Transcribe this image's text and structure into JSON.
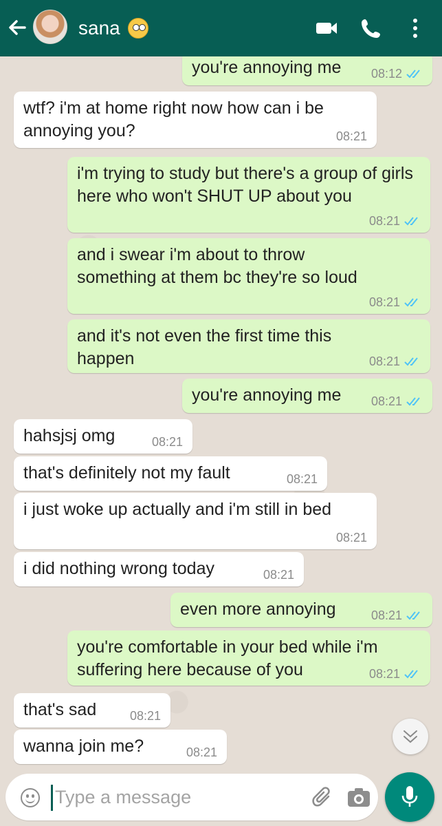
{
  "header": {
    "contact_name": "sana",
    "status_emoji": "face-with-rolling-eyes",
    "icons": [
      "back-arrow-icon",
      "video-call-icon",
      "voice-call-icon",
      "more-options-icon"
    ],
    "color": "#075e54"
  },
  "messages": [
    {
      "direction": "out",
      "text": "you're annoying me",
      "time": "08:12",
      "ticks": "read"
    },
    {
      "direction": "in",
      "text": "wtf? i'm at home right now how can i be annoying you?",
      "time": "08:21"
    },
    {
      "direction": "out",
      "text": "i'm trying to study but there's a group of girls here who won't SHUT UP about you",
      "time": "08:21",
      "ticks": "read"
    },
    {
      "direction": "out",
      "text": "and i swear i'm about to throw something at them bc they're so loud",
      "time": "08:21",
      "ticks": "read"
    },
    {
      "direction": "out",
      "text": "and it's not even the first time this happen",
      "time": "08:21",
      "ticks": "read"
    },
    {
      "direction": "out",
      "text": "you're annoying me",
      "time": "08:21",
      "ticks": "read"
    },
    {
      "direction": "in",
      "text": "hahsjsj omg",
      "time": "08:21"
    },
    {
      "direction": "in",
      "text": "that's definitely not my fault",
      "time": "08:21"
    },
    {
      "direction": "in",
      "text": "i just woke up actually and i'm still in bed",
      "time": "08:21"
    },
    {
      "direction": "in",
      "text": "i did nothing wrong today",
      "time": "08:21"
    },
    {
      "direction": "out",
      "text": "even more annoying",
      "time": "08:21",
      "ticks": "read"
    },
    {
      "direction": "out",
      "text": "you're comfortable in your bed while i'm suffering here because of you",
      "time": "08:21",
      "ticks": "read"
    },
    {
      "direction": "in",
      "text": "that's sad",
      "time": "08:21"
    },
    {
      "direction": "in",
      "text": "wanna join me?",
      "time": "08:21"
    }
  ],
  "input": {
    "placeholder": "Type a message",
    "value": ""
  },
  "colors": {
    "outgoing_bubble": "#dcf8c6",
    "incoming_bubble": "#ffffff",
    "read_ticks": "#4fc3f7",
    "mic_button": "#00897b"
  }
}
